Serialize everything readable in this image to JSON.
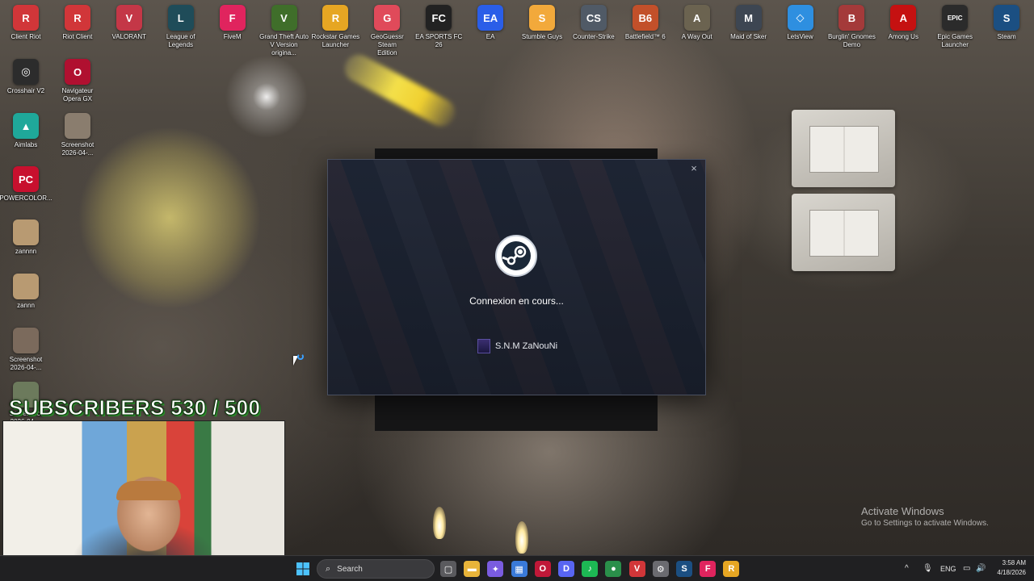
{
  "desktop": {
    "top_icons": [
      {
        "label": "Client Riot",
        "icon": "riot-client-icon",
        "color": "#d13639",
        "glyph": "R"
      },
      {
        "label": "Riot Client",
        "icon": "riot-client-icon",
        "color": "#d13639",
        "glyph": "R"
      },
      {
        "label": "VALORANT",
        "icon": "valorant-icon",
        "color": "#c43747",
        "glyph": "V"
      },
      {
        "label": "League of\nLegends",
        "icon": "league-of-legends-icon",
        "color": "#1f4c59",
        "glyph": "L"
      },
      {
        "label": "FiveM",
        "icon": "fivem-icon",
        "color": "#e0245e",
        "glyph": "F"
      },
      {
        "label": "Grand Theft Auto\nV Version origina...",
        "icon": "gta-v-icon",
        "color": "#3f6e2a",
        "glyph": "V"
      },
      {
        "label": "Rockstar Games\nLauncher",
        "icon": "rockstar-icon",
        "color": "#e6a623",
        "glyph": "R"
      },
      {
        "label": "GeoGuessr Steam\nEdition",
        "icon": "geoguessr-icon",
        "color": "#e04a5a",
        "glyph": "G"
      },
      {
        "label": "EA SPORTS FC 26",
        "icon": "ea-fc-icon",
        "color": "#222222",
        "glyph": "FC"
      },
      {
        "label": "EA",
        "icon": "ea-icon",
        "color": "#2a5ee8",
        "glyph": "EA"
      },
      {
        "label": "Stumble Guys",
        "icon": "stumble-guys-icon",
        "color": "#f2a93b",
        "glyph": "S"
      },
      {
        "label": "Counter-Strike",
        "icon": "counter-strike-icon",
        "color": "#505a66",
        "glyph": "CS"
      },
      {
        "label": "Battlefield™ 6",
        "icon": "battlefield-icon",
        "color": "#c2502a",
        "glyph": "B6"
      },
      {
        "label": "A Way Out",
        "icon": "a-way-out-icon",
        "color": "#6b6350",
        "glyph": "A"
      },
      {
        "label": "Maid of Sker",
        "icon": "maid-of-sker-icon",
        "color": "#3d4652",
        "glyph": "M"
      },
      {
        "label": "LetsView",
        "icon": "letsview-icon",
        "color": "#2e8fe0",
        "glyph": "◇"
      },
      {
        "label": "Burglin' Gnomes\nDemo",
        "icon": "burglin-gnomes-icon",
        "color": "#a43a3a",
        "glyph": "B"
      },
      {
        "label": "Among Us",
        "icon": "among-us-icon",
        "color": "#c51111",
        "glyph": "A"
      },
      {
        "label": "Epic Games\nLauncher",
        "icon": "epic-games-icon",
        "color": "#2b2b2b",
        "glyph": "EPIC"
      },
      {
        "label": "Steam",
        "icon": "steam-icon",
        "color": "#1b4f82",
        "glyph": "S"
      }
    ],
    "left_icons": [
      {
        "label": "Crosshair V2",
        "icon": "crosshair-icon",
        "color": "#2c2c2c",
        "glyph": "◎"
      },
      {
        "label": "Navigateur\nOpera GX",
        "icon": "opera-gx-icon",
        "color": "#b01030",
        "glyph": "O"
      },
      {
        "label": "Aimlabs",
        "icon": "aimlabs-icon",
        "color": "#1fa89a",
        "glyph": "▲"
      },
      {
        "label": "Screenshot\n2026-04-...",
        "icon": "screenshot-file-icon",
        "color": "#8a7d6e",
        "glyph": ""
      },
      {
        "label": "POWERCOLOR...",
        "icon": "powercolor-icon",
        "color": "#c8102e",
        "glyph": "PC"
      },
      {
        "label": "zannnn",
        "icon": "image-file-icon",
        "color": "#b89a72",
        "glyph": ""
      },
      {
        "label": "zannn",
        "icon": "image-file-icon",
        "color": "#b89a72",
        "glyph": ""
      },
      {
        "label": "Screenshot\n2026-04-...",
        "icon": "screenshot-file-icon",
        "color": "#7b6a5c",
        "glyph": ""
      },
      {
        "label": "Screenshot\n2026-04-...",
        "icon": "screenshot-file-icon",
        "color": "#6c7a5c",
        "glyph": ""
      }
    ]
  },
  "steam_dialog": {
    "status": "Connexion en cours...",
    "username": "S.N.M ZaNouNi",
    "close_symbol": "×"
  },
  "overlay": {
    "subscribers_text": "SUBSCRIBERS 530 / 500"
  },
  "watermark": {
    "line1": "Activate Windows",
    "line2": "Go to Settings to activate Windows."
  },
  "taskbar": {
    "search_placeholder": "Search",
    "apps": [
      {
        "icon": "task-view-icon",
        "color": "#5a5a5e",
        "glyph": "▢"
      },
      {
        "icon": "file-explorer-icon",
        "color": "#e8b43a",
        "glyph": "▬"
      },
      {
        "icon": "copilot-icon",
        "color": "#7a5ce0",
        "glyph": "✦"
      },
      {
        "icon": "microsoft-store-icon",
        "color": "#3a7ad9",
        "glyph": "▦"
      },
      {
        "icon": "opera-gx-icon",
        "color": "#c01838",
        "glyph": "O"
      },
      {
        "icon": "discord-icon",
        "color": "#5865f2",
        "glyph": "D"
      },
      {
        "icon": "spotify-icon",
        "color": "#1db954",
        "glyph": "♪"
      },
      {
        "icon": "chrome-icon",
        "color": "#2a8f4a",
        "glyph": "●"
      },
      {
        "icon": "riot-vanguard-icon",
        "color": "#d13639",
        "glyph": "V"
      },
      {
        "icon": "settings-icon",
        "color": "#6b6b70",
        "glyph": "⚙"
      },
      {
        "icon": "steam-icon",
        "color": "#1b4f82",
        "glyph": "S"
      },
      {
        "icon": "fivem-icon",
        "color": "#e0245e",
        "glyph": "F"
      },
      {
        "icon": "rockstar-icon",
        "color": "#e6a623",
        "glyph": "R"
      }
    ],
    "tray": {
      "language": "ENG",
      "time": "3:58 AM",
      "date": "4/18/2026"
    }
  }
}
